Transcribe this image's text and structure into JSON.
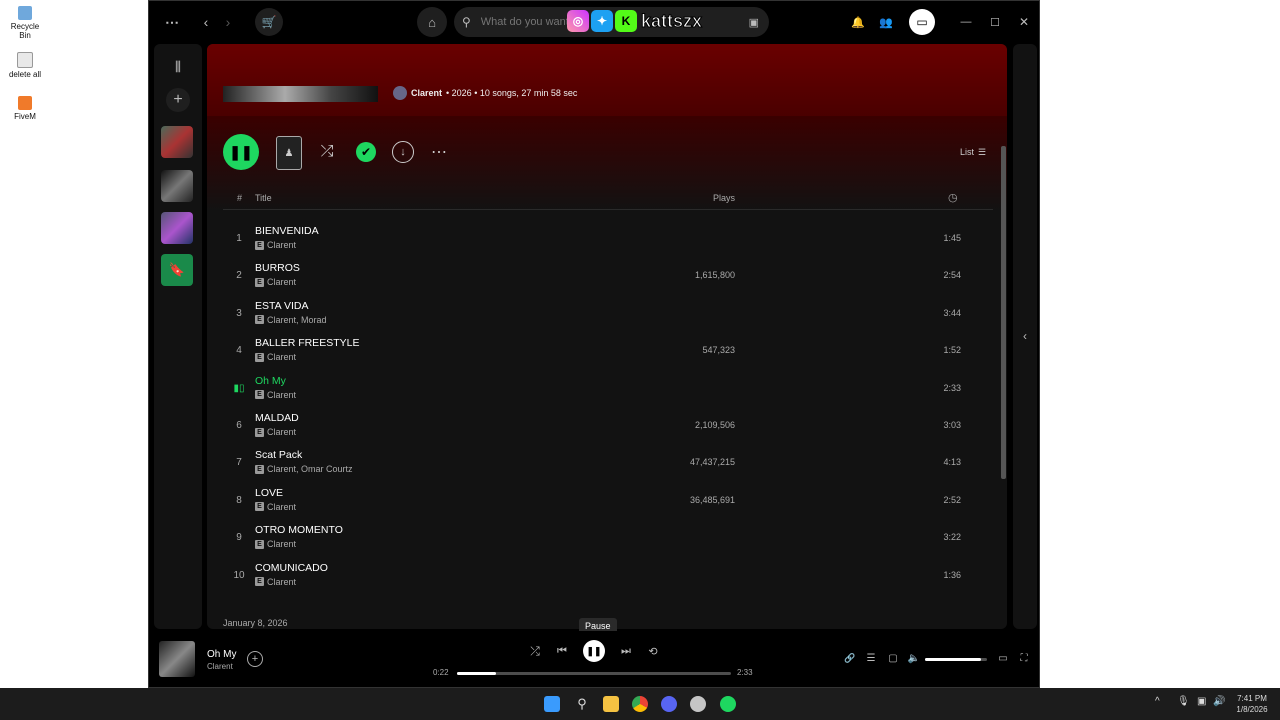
{
  "desktop": {
    "icons": [
      {
        "label": "Recycle Bin",
        "color": "#6fa8dc"
      },
      {
        "label": "delete all",
        "color": "#dddddd"
      },
      {
        "label": "FiveM",
        "color": "#f07a2a"
      }
    ]
  },
  "titlebar": {
    "search_placeholder": "What do you want to play?",
    "overlay_handle": "kattszx"
  },
  "album": {
    "artist": "Clarent",
    "meta": "• 2026 • 10 songs, 27 min 58 sec"
  },
  "header": {
    "view_label": "List",
    "col_num": "#",
    "col_title": "Title",
    "col_plays": "Plays"
  },
  "tracks": [
    {
      "num": "1",
      "title": "BIENVENIDA",
      "artist": "Clarent",
      "plays": "",
      "dur": "1:45"
    },
    {
      "num": "2",
      "title": "BURROS",
      "artist": "Clarent",
      "plays": "1,615,800",
      "dur": "2:54"
    },
    {
      "num": "3",
      "title": "ESTA VIDA",
      "artist": "Clarent, Morad",
      "plays": "",
      "dur": "3:44"
    },
    {
      "num": "4",
      "title": "BALLER FREESTYLE",
      "artist": "Clarent",
      "plays": "547,323",
      "dur": "1:52"
    },
    {
      "num": "",
      "title": "Oh My",
      "artist": "Clarent",
      "plays": "",
      "dur": "2:33"
    },
    {
      "num": "6",
      "title": "MALDAD",
      "artist": "Clarent",
      "plays": "2,109,506",
      "dur": "3:03"
    },
    {
      "num": "7",
      "title": "Scat Pack",
      "artist": "Clarent, Omar Courtz",
      "plays": "47,437,215",
      "dur": "4:13"
    },
    {
      "num": "8",
      "title": "LOVE",
      "artist": "Clarent",
      "plays": "36,485,691",
      "dur": "2:52"
    },
    {
      "num": "9",
      "title": "OTRO MOMENTO",
      "artist": "Clarent",
      "plays": "",
      "dur": "3:22"
    },
    {
      "num": "10",
      "title": "COMUNICADO",
      "artist": "Clarent",
      "plays": "",
      "dur": "1:36"
    }
  ],
  "release_date": "January 8, 2026",
  "player": {
    "track": "Oh My",
    "artist": "Clarent",
    "elapsed": "0:22",
    "total": "2:33",
    "progress": 0.144,
    "volume": 0.9,
    "tooltip": "Pause"
  },
  "taskbar": {
    "time": "7:41 PM",
    "date": "1/8/2026"
  },
  "colors": {
    "accent": "#1ed760",
    "hero": "#6a0000"
  }
}
